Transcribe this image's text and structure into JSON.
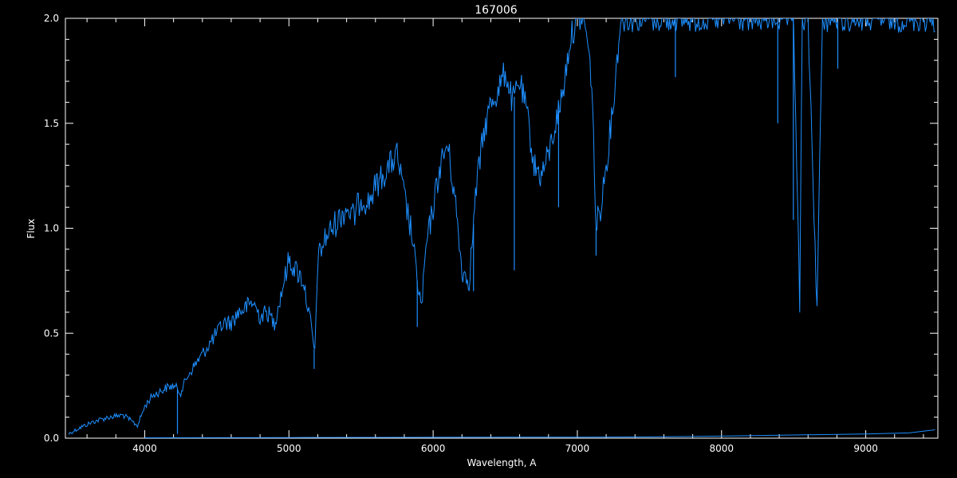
{
  "chart_data": {
    "type": "line",
    "title": "167006",
    "xlabel": "Wavelength, A",
    "ylabel": "Flux",
    "xlim": [
      3450,
      9500
    ],
    "ylim": [
      0,
      2.0
    ],
    "x_ticks": [
      4000,
      5000,
      6000,
      7000,
      8000,
      9000
    ],
    "y_ticks": [
      0.0,
      0.5,
      1.0,
      1.5,
      2.0
    ],
    "x_tick_labels": [
      "4000",
      "5000",
      "6000",
      "7000",
      "8000",
      "9000"
    ],
    "y_tick_labels": [
      "0.0",
      "0.5",
      "1.0",
      "1.5",
      "2.0"
    ],
    "grid": false,
    "series": [
      {
        "color": "#1e8fff",
        "x": [
          3470,
          3550,
          3650,
          3750,
          3850,
          3950,
          4000,
          4050,
          4100,
          4150,
          4200,
          4250,
          4300,
          4350,
          4400,
          4450,
          4500,
          4550,
          4600,
          4650,
          4700,
          4750,
          4800,
          4850,
          4900,
          4950,
          5000,
          5050,
          5100,
          5150,
          5180,
          5200,
          5250,
          5300,
          5350,
          5400,
          5450,
          5500,
          5550,
          5600,
          5650,
          5700,
          5750,
          5800,
          5850,
          5890,
          5920,
          5950,
          6000,
          6050,
          6100,
          6150,
          6200,
          6250,
          6300,
          6350,
          6400,
          6450,
          6500,
          6550,
          6600,
          6650,
          6700,
          6750,
          6800,
          6850,
          6900,
          6950,
          7000,
          7050,
          7100,
          7130,
          7160,
          7200,
          7250,
          7300,
          7350,
          7400,
          7500,
          7600,
          7700,
          7800,
          7900,
          8000,
          8100,
          8200,
          8300,
          8400,
          8450,
          8500,
          8542,
          8560,
          8600,
          8662,
          8700,
          8800,
          8900,
          9000,
          9100,
          9200,
          9300,
          9400,
          9480
        ],
        "y": [
          0.02,
          0.05,
          0.08,
          0.1,
          0.11,
          0.06,
          0.15,
          0.2,
          0.22,
          0.24,
          0.25,
          0.22,
          0.3,
          0.35,
          0.4,
          0.45,
          0.5,
          0.55,
          0.55,
          0.6,
          0.62,
          0.65,
          0.58,
          0.6,
          0.55,
          0.7,
          0.85,
          0.8,
          0.75,
          0.55,
          0.4,
          0.85,
          0.95,
          1.0,
          1.05,
          1.1,
          1.05,
          1.15,
          1.12,
          1.2,
          1.25,
          1.3,
          1.35,
          1.15,
          0.98,
          0.75,
          0.62,
          0.9,
          1.1,
          1.3,
          1.4,
          1.15,
          0.8,
          0.75,
          1.2,
          1.45,
          1.6,
          1.65,
          1.75,
          1.6,
          1.7,
          1.55,
          1.3,
          1.25,
          1.35,
          1.5,
          1.65,
          1.9,
          2.0,
          2.0,
          1.7,
          1.0,
          1.1,
          1.3,
          1.6,
          2.0,
          2.0,
          2.0,
          2.0,
          2.0,
          2.0,
          2.0,
          2.0,
          2.0,
          2.0,
          2.0,
          2.0,
          2.0,
          2.0,
          2.0,
          0.62,
          2.0,
          2.0,
          0.62,
          2.0,
          2.0,
          2.0,
          2.0,
          2.0,
          2.0,
          2.0,
          2.0,
          2.0
        ]
      },
      {
        "color": "#1e8fff",
        "x": [
          4000,
          5000,
          6000,
          7000,
          7500,
          8000,
          8500,
          9000,
          9300,
          9480
        ],
        "y": [
          0.002,
          0.003,
          0.004,
          0.005,
          0.006,
          0.01,
          0.015,
          0.02,
          0.025,
          0.04
        ]
      }
    ],
    "absorption_lines": [
      {
        "x": 4227,
        "y": 0.02
      },
      {
        "x": 5175,
        "y": 0.33
      },
      {
        "x": 5890,
        "y": 0.53
      },
      {
        "x": 6280,
        "y": 0.7
      },
      {
        "x": 6563,
        "y": 0.8
      },
      {
        "x": 6870,
        "y": 1.1
      },
      {
        "x": 7130,
        "y": 0.87
      },
      {
        "x": 7680,
        "y": 1.72
      },
      {
        "x": 8390,
        "y": 1.5
      },
      {
        "x": 8498,
        "y": 1.04
      },
      {
        "x": 8542,
        "y": 0.62
      },
      {
        "x": 8662,
        "y": 0.62
      },
      {
        "x": 8806,
        "y": 1.76
      }
    ]
  }
}
